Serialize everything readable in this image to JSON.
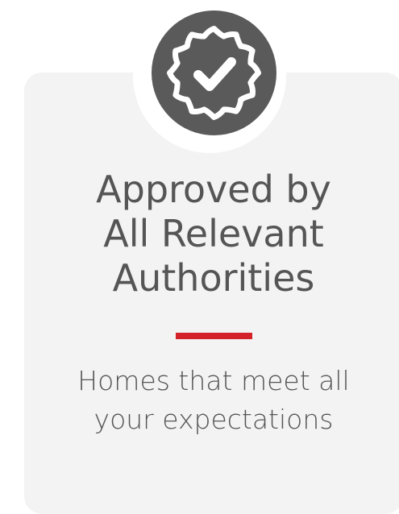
{
  "badge": {
    "icon": "verified-badge-check-icon",
    "circle_color": "#5a5a5a",
    "icon_color": "#ffffff"
  },
  "card": {
    "background": "#f3f3f3",
    "title_lines": [
      "Approved by",
      "All Relevant",
      "Authorities"
    ],
    "subtitle_lines": [
      "Homes that meet all",
      "your expectations"
    ],
    "accent_color": "#d3222a",
    "text_color": "#555555"
  }
}
